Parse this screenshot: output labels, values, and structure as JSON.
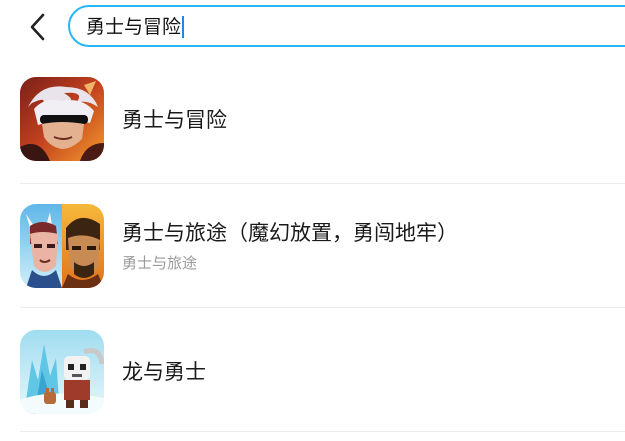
{
  "search": {
    "query": "勇士与冒险",
    "back_icon": "chevron-left-icon",
    "accent_color": "#29b6f6"
  },
  "results": [
    {
      "title": "勇士与冒险",
      "icon": "warrior-hero-app-icon"
    },
    {
      "title": "勇士与旅途（魔幻放置，勇闯地牢）",
      "subtitle": "勇士与旅途",
      "icon": "warriors-journey-app-icon"
    },
    {
      "title": "龙与勇士",
      "icon": "dragon-and-warrior-app-icon"
    }
  ]
}
